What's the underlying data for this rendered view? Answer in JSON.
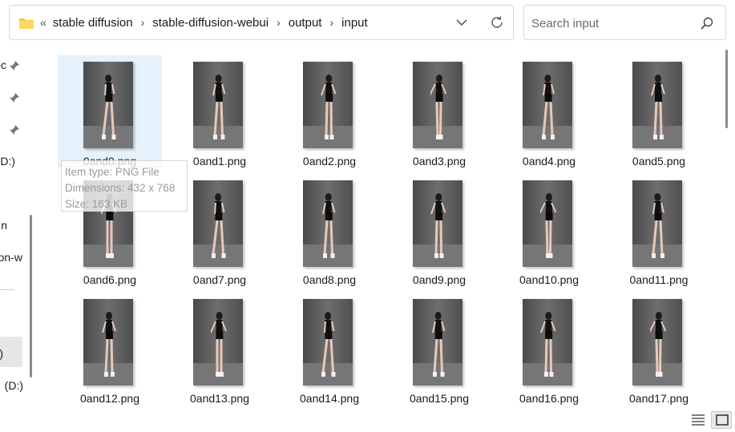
{
  "address": {
    "overflow_glyph": "«",
    "separator": "›",
    "crumbs": [
      "stable diffusion",
      "stable-diffusion-webui",
      "output",
      "input"
    ]
  },
  "search": {
    "placeholder": "Search input"
  },
  "nav": {
    "items": [
      {
        "label": "ec",
        "pinned": true
      },
      {
        "label": "",
        "pinned": true
      },
      {
        "label": "",
        "pinned": true
      },
      {
        "label": "D:)",
        "pinned": false
      },
      {
        "label": "n",
        "pinned": false
      },
      {
        "label": "on-w",
        "pinned": false
      },
      {
        "label": ")",
        "pinned": false
      },
      {
        "label": "(D:)",
        "pinned": false
      }
    ]
  },
  "files": [
    {
      "name": "0and0.png",
      "selected": true
    },
    {
      "name": "0and1.png"
    },
    {
      "name": "0and2.png"
    },
    {
      "name": "0and3.png"
    },
    {
      "name": "0and4.png"
    },
    {
      "name": "0and5.png"
    },
    {
      "name": "0and6.png"
    },
    {
      "name": "0and7.png"
    },
    {
      "name": "0and8.png"
    },
    {
      "name": "0and9.png"
    },
    {
      "name": "0and10.png"
    },
    {
      "name": "0and11.png"
    },
    {
      "name": "0and12.png"
    },
    {
      "name": "0and13.png"
    },
    {
      "name": "0and14.png"
    },
    {
      "name": "0and15.png"
    },
    {
      "name": "0and16.png"
    },
    {
      "name": "0and17.png"
    }
  ],
  "tooltip": {
    "type_line": "Item type: PNG File",
    "dimensions_line": "Dimensions: 432 x 768",
    "size_line": "Size: 163 KB"
  },
  "view": {
    "active": "large-icons"
  },
  "colors": {
    "selection": "#e5f1fb",
    "folder": "#f5c342",
    "accent": "#0067c0"
  },
  "icons": [
    "folder-icon",
    "chevron-down-icon",
    "refresh-icon",
    "search-icon",
    "pin-icon",
    "details-view-icon",
    "large-icons-view-icon"
  ]
}
